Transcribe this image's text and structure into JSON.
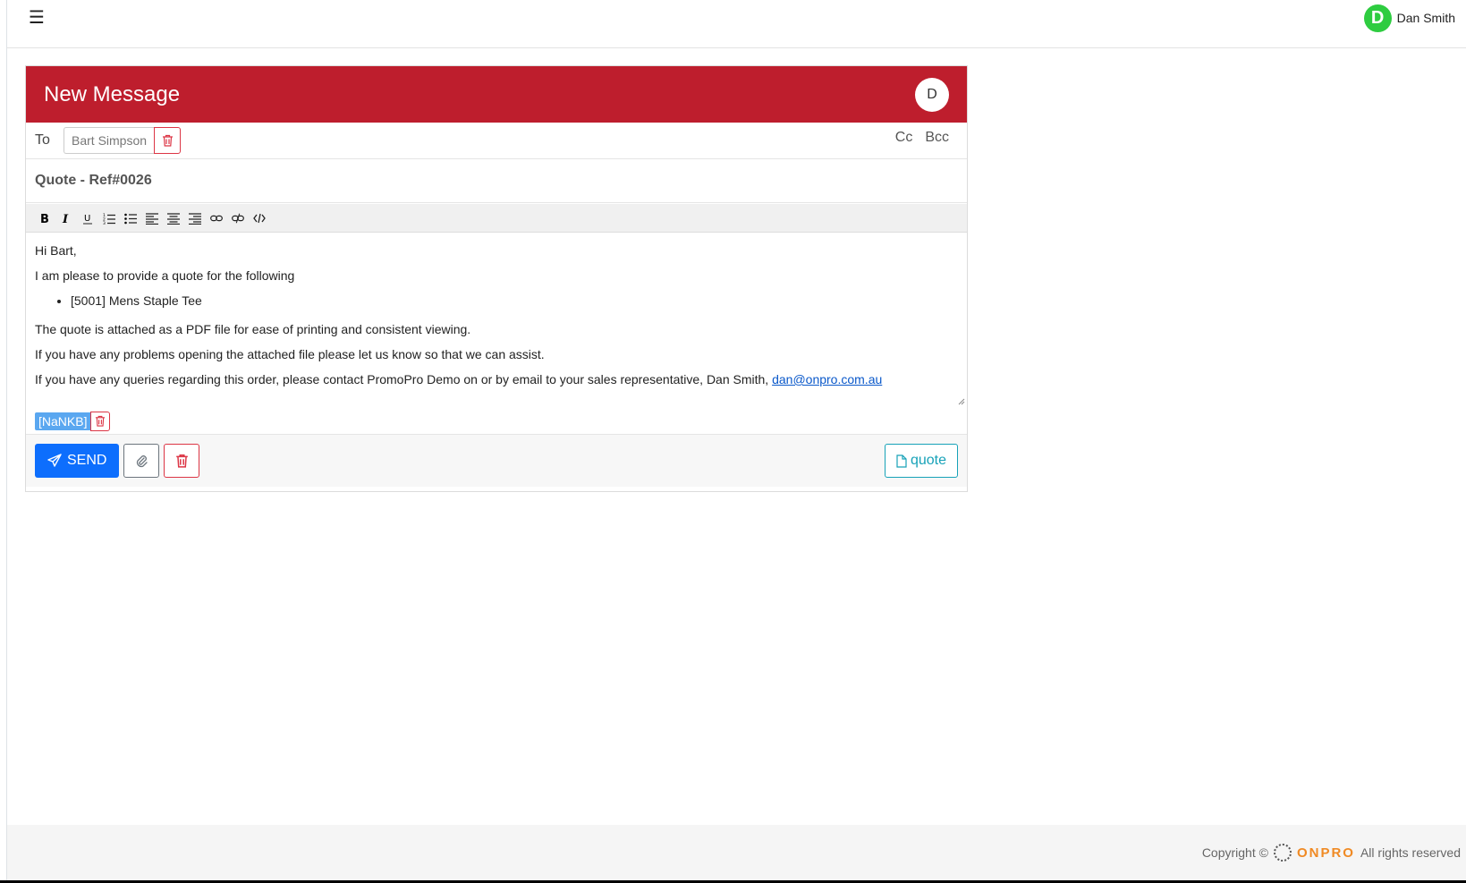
{
  "topbar": {
    "menu_icon": "hamburger-icon",
    "user_initial": "D",
    "user_name": "Dan Smith"
  },
  "compose": {
    "title": "New Message",
    "header_avatar": "D",
    "to_label": "To",
    "recipient": "Bart Simpson",
    "cc_label": "Cc",
    "bcc_label": "Bcc",
    "subject": "Quote - Ref#0026",
    "toolbar": [
      "bold-icon",
      "italic-icon",
      "underline-icon",
      "ordered-list-icon",
      "unordered-list-icon",
      "align-left-icon",
      "align-center-icon",
      "align-right-icon",
      "link-icon",
      "unlink-icon",
      "code-icon"
    ],
    "body": {
      "greeting": "Hi Bart,",
      "intro": "I am please to provide a quote for the following",
      "items": [
        "[5001] Mens Staple Tee"
      ],
      "line1": "The quote is attached as a PDF file for ease of printing and consistent viewing.",
      "line2": "If you have any problems opening the attached file please let us know so that we can assist.",
      "line3": "If you have any queries regarding this order, please contact PromoPro Demo on or by email to your sales representative, Dan Smith, ",
      "email_link": "dan@onpro.com.au"
    },
    "attachment": "[NaNKB]",
    "send_label": "SEND",
    "quote_label": "quote"
  },
  "footer": {
    "copyright": "Copyright ©",
    "brand": "ONPRO",
    "rights": "All rights reserved"
  },
  "colors": {
    "header_red": "#be1e2d",
    "send_blue": "#0d6efd",
    "danger": "#dc3545",
    "info": "#17a2b8",
    "avatar_green": "#2ecc40",
    "brand_orange": "#f08a24"
  }
}
